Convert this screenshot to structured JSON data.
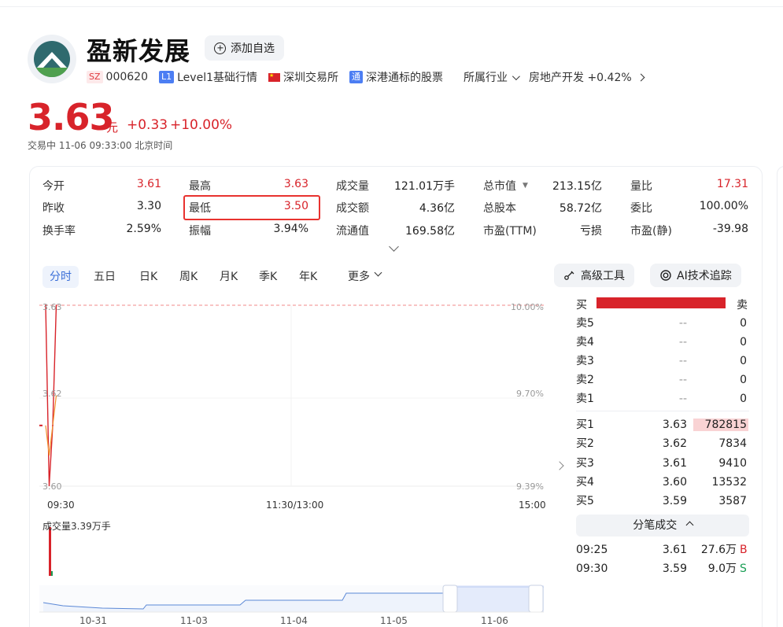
{
  "stock": {
    "name": "盈新发展",
    "add_watch": "添加自选",
    "exchange_badge": "SZ",
    "code": "000620",
    "level_badge": "L1",
    "level_label": "Level1基础行情",
    "exchange": "深圳交易所",
    "connect_badge": "通",
    "connect": "深港通标的股票",
    "industry_label": "所属行业",
    "industry": "房地产开发 +0.42%",
    "price": "3.63",
    "price_unit": "元",
    "change": "+0.33",
    "change_pct": "+10.00%",
    "status": "交易中  11-06 09:33:00  北京时间"
  },
  "quote": {
    "col1": [
      {
        "label": "今开",
        "value": "3.61"
      },
      {
        "label": "昨收",
        "value": "3.30"
      },
      {
        "label": "换手率",
        "value": "2.59%"
      }
    ],
    "col2": [
      {
        "label": "最高",
        "value": "3.63"
      },
      {
        "label": "最低",
        "value": "3.50"
      },
      {
        "label": "振幅",
        "value": "3.94%"
      }
    ],
    "col3": [
      {
        "label": "成交量",
        "value": "121.01万手"
      },
      {
        "label": "成交额",
        "value": "4.36亿"
      },
      {
        "label": "流通值",
        "value": "169.58亿"
      }
    ],
    "col4": [
      {
        "label": "总市值",
        "value": "213.15亿"
      },
      {
        "label": "总股本",
        "value": "58.72亿"
      },
      {
        "label": "市盈(TTM)",
        "value": "亏损"
      }
    ],
    "col5": [
      {
        "label": "量比",
        "value": "17.31"
      },
      {
        "label": "委比",
        "value": "100.00%"
      },
      {
        "label": "市盈(静)",
        "value": "-39.98"
      }
    ]
  },
  "tabs": [
    "分时",
    "五日",
    "日K",
    "周K",
    "月K",
    "季K",
    "年K",
    "更多"
  ],
  "tools": {
    "advanced": "高级工具",
    "ai": "AI技术追踪"
  },
  "chart": {
    "y_left": [
      "3.63",
      "3.62",
      "3.60"
    ],
    "y_right": [
      "10.00%",
      "9.70%",
      "9.39%"
    ],
    "x_labels": [
      "09:30",
      "11:30/13:00",
      "15:00"
    ],
    "volume_label": "成交量3.39万手",
    "nav_dates": [
      "10-31",
      "11-03",
      "11-04",
      "11-05",
      "11-06"
    ]
  },
  "chart_data": {
    "type": "line",
    "x": [
      "09:30",
      "09:31",
      "09:32",
      "09:33"
    ],
    "series": [
      {
        "values": [
          3.63,
          3.6,
          3.61,
          3.63
        ]
      }
    ],
    "ylim": [
      3.6,
      3.63
    ]
  },
  "orderbook": {
    "buy_label": "买",
    "sell_label": "卖",
    "asks": [
      {
        "label": "卖5",
        "price": "--",
        "vol": "0"
      },
      {
        "label": "卖4",
        "price": "--",
        "vol": "0"
      },
      {
        "label": "卖3",
        "price": "--",
        "vol": "0"
      },
      {
        "label": "卖2",
        "price": "--",
        "vol": "0"
      },
      {
        "label": "卖1",
        "price": "--",
        "vol": "0"
      }
    ],
    "bids": [
      {
        "label": "买1",
        "price": "3.63",
        "vol": "782815"
      },
      {
        "label": "买2",
        "price": "3.62",
        "vol": "7834"
      },
      {
        "label": "买3",
        "price": "3.61",
        "vol": "9410"
      },
      {
        "label": "买4",
        "price": "3.60",
        "vol": "13532"
      },
      {
        "label": "买5",
        "price": "3.59",
        "vol": "3587"
      }
    ],
    "ticks_label": "分笔成交",
    "ticks": [
      {
        "time": "09:25",
        "price": "3.61",
        "vol": "27.6万",
        "side": "B"
      },
      {
        "time": "09:30",
        "price": "3.59",
        "vol": "9.0万",
        "side": "S"
      }
    ]
  },
  "colors": {
    "up": "#d8232a",
    "down": "#1a9e55",
    "accent": "#3a6fd8"
  }
}
